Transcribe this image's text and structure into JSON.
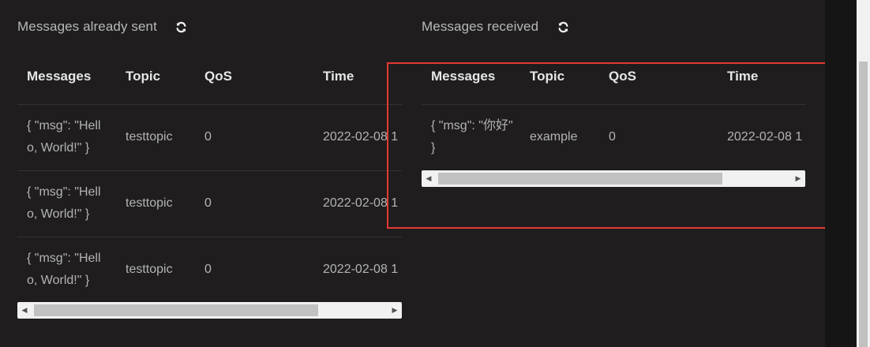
{
  "colors": {
    "background": "#1f1d1e",
    "header_text": "#e6e6e6",
    "cell_text": "#b4b4b4",
    "highlight": "#e53935"
  },
  "sent": {
    "title": "Messages already sent",
    "refresh_icon": "refresh-icon",
    "columns": [
      "Messages",
      "Topic",
      "QoS",
      "Time"
    ],
    "rows": [
      {
        "message": "{ \"msg\": \"Hello, World!\" }",
        "topic": "testtopic",
        "qos": "0",
        "time": "2022-02-08 1"
      },
      {
        "message": "{ \"msg\": \"Hello, World!\" }",
        "topic": "testtopic",
        "qos": "0",
        "time": "2022-02-08 1"
      },
      {
        "message": "{ \"msg\": \"Hello, World!\" }",
        "topic": "testtopic",
        "qos": "0",
        "time": "2022-02-08 1"
      }
    ]
  },
  "received": {
    "title": "Messages received",
    "refresh_icon": "refresh-icon",
    "columns": [
      "Messages",
      "Topic",
      "QoS",
      "Time"
    ],
    "rows": [
      {
        "message": "{ \"msg\": \"你好\" }",
        "topic": "example",
        "qos": "0",
        "time": "2022-02-08 1"
      }
    ]
  }
}
